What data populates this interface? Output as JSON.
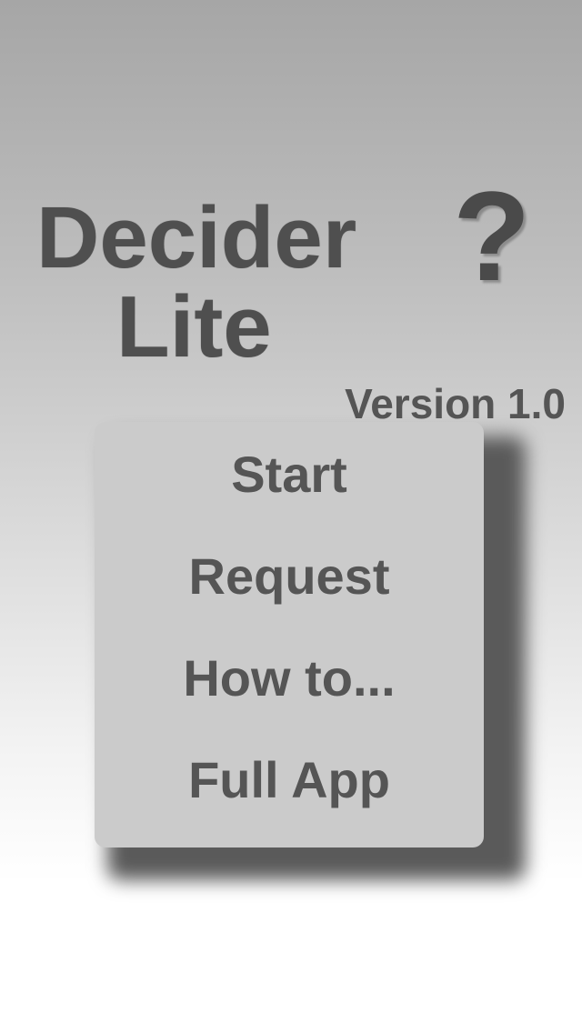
{
  "header": {
    "title_line1": "Decider",
    "title_line2": "Lite",
    "logo_symbol": "?",
    "version": "Version 1.0"
  },
  "menu": {
    "items": [
      {
        "label": "Start"
      },
      {
        "label": "Request"
      },
      {
        "label": "How to..."
      },
      {
        "label": "Full App"
      }
    ]
  },
  "colors": {
    "text": "#555555",
    "panel": "#cbcbcb",
    "shadow": "#5a5a5a"
  }
}
